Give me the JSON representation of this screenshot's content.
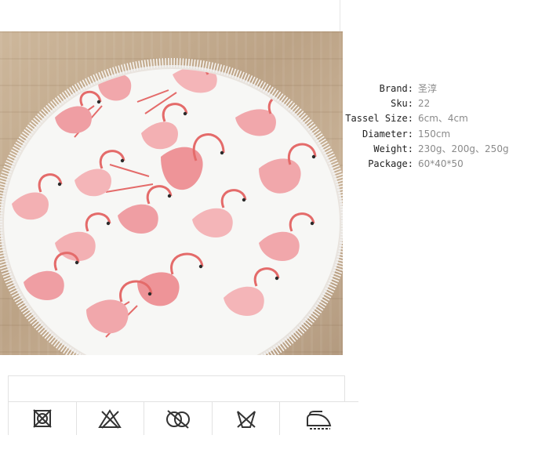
{
  "product_image": {
    "subject": "round beach towel with flamingo print and white tassels"
  },
  "specs": [
    {
      "label": "Brand:",
      "value": "圣淳"
    },
    {
      "label": "Sku:",
      "value": "22"
    },
    {
      "label": "Tassel Size:",
      "value": "6cm、4cm"
    },
    {
      "label": "Diameter:",
      "value": "150cm"
    },
    {
      "label": "Weight:",
      "value": "230g、200g、250g"
    },
    {
      "label": "Package:",
      "value": "60*40*50"
    }
  ],
  "care_icons": [
    {
      "icon": "tumble-dry-prohibited-icon"
    },
    {
      "icon": "bleach-prohibited-icon"
    },
    {
      "icon": "dry-clean-prohibited-icon"
    },
    {
      "icon": "wash-prohibited-icon"
    },
    {
      "icon": "iron-icon"
    }
  ],
  "colors": {
    "flamingo": "#e46b6a",
    "flamingo_light": "#f3b0b3",
    "towel": "#f7f7f5",
    "floor": "#c4ab8f"
  }
}
